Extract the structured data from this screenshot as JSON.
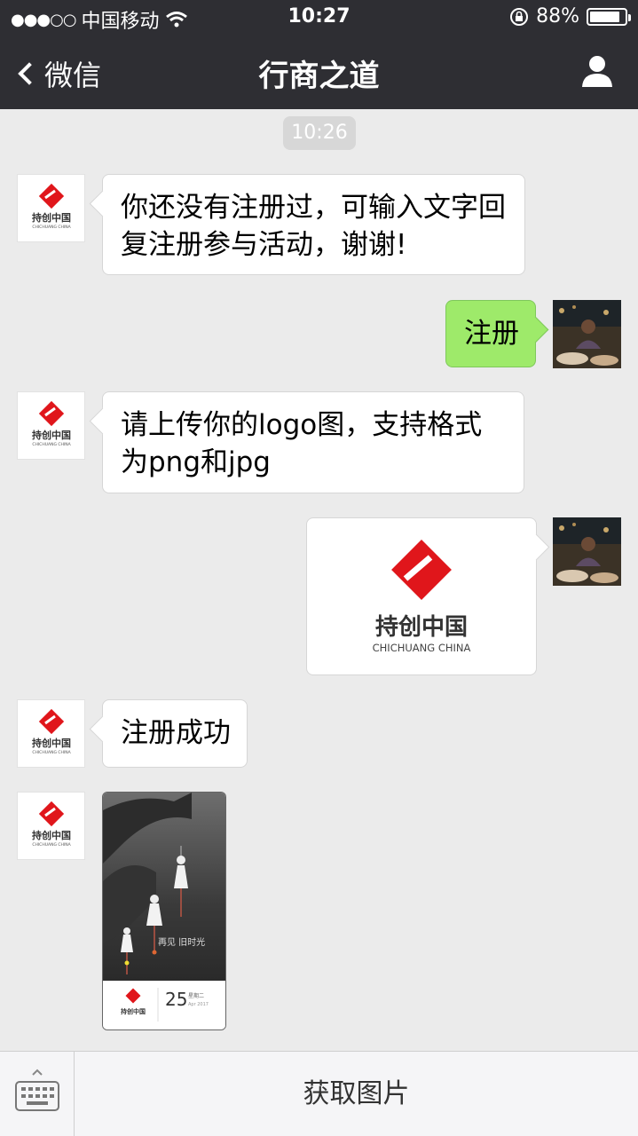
{
  "status_bar": {
    "carrier": "中国移动",
    "time": "10:27",
    "battery_percent": "88%",
    "battery_level": 0.88,
    "icons": [
      "signal-dots-icon",
      "wifi-icon",
      "rotation-lock-icon",
      "battery-icon"
    ]
  },
  "nav": {
    "back_label": "微信",
    "title": "行商之道",
    "profile_icon": "person-icon"
  },
  "chat": {
    "timestamp": "10:26",
    "messages": [
      {
        "side": "left",
        "text": "你还没有注册过，可输入文字回复注册参与活动，谢谢!"
      },
      {
        "side": "right",
        "text": "注册"
      },
      {
        "side": "left",
        "text": "请上传你的logo图，支持格式为png和jpg"
      },
      {
        "side": "right",
        "type": "image",
        "logo_cn": "持创中国",
        "logo_en": "CHICHUANG CHINA"
      },
      {
        "side": "left",
        "text": "注册成功"
      },
      {
        "side": "left",
        "type": "image",
        "poster": {
          "headline": "再见 旧时光",
          "day": "25",
          "weekday": "星期二",
          "month": "Apr 2017",
          "logo_cn": "持创中国"
        }
      }
    ],
    "avatar_logo": {
      "cn": "持创中国",
      "en": "CHICHUANG CHINA"
    }
  },
  "bottom_bar": {
    "keyboard_icon": "keyboard-icon",
    "menu_label": "获取图片"
  },
  "colors": {
    "nav_bg": "#2e2e33",
    "chat_bg": "#ebebeb",
    "sent_bubble": "#9eea6a",
    "logo_red": "#e0161b"
  }
}
